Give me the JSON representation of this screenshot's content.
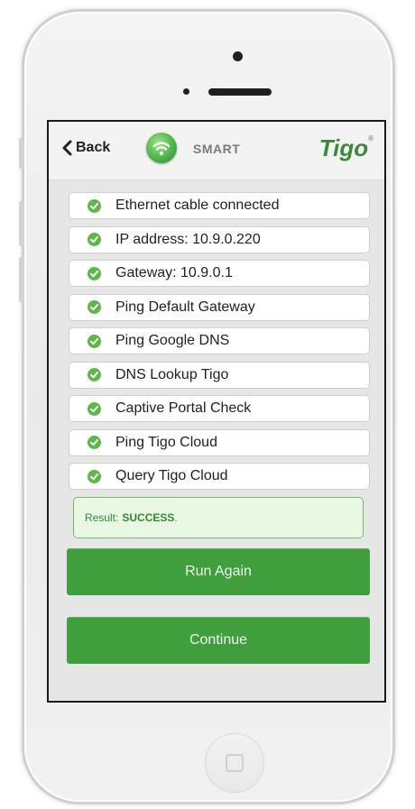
{
  "header": {
    "back_label": "Back",
    "device_label": "SMART",
    "brand": "Tigo",
    "brand_mark": "®"
  },
  "checks": [
    {
      "label": "Ethernet cable connected"
    },
    {
      "label": "IP address: 10.9.0.220"
    },
    {
      "label": "Gateway: 10.9.0.1"
    },
    {
      "label": "Ping Default Gateway"
    },
    {
      "label": "Ping Google DNS"
    },
    {
      "label": "DNS Lookup Tigo"
    },
    {
      "label": "Captive Portal Check"
    },
    {
      "label": "Ping Tigo Cloud"
    },
    {
      "label": "Query Tigo Cloud"
    }
  ],
  "result": {
    "label": "Result:",
    "status": "SUCCESS",
    "suffix": "."
  },
  "buttons": {
    "run_again": "Run Again",
    "continue": "Continue"
  },
  "colors": {
    "accent_green": "#3f9f3c",
    "check_green": "#5cb947",
    "result_bg": "#e9f8e3",
    "brand_green": "#3a8a3b"
  },
  "icons": {
    "back": "chevron-left-icon",
    "wifi": "wifi-icon",
    "check": "check-circle-icon",
    "home": "home-button-icon"
  }
}
